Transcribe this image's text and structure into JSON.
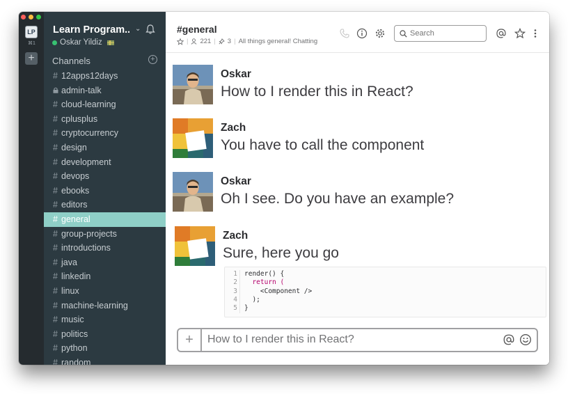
{
  "colors": {
    "sidebar_bg": "#2c3a41",
    "strip_bg": "#252b2f",
    "active_channel": "#8fcfc7",
    "presence": "#38c172",
    "traffic_red": "#fc605c",
    "traffic_yellow": "#fdbc40",
    "traffic_green": "#34c84a"
  },
  "strip": {
    "team_initials": "LP",
    "team_shortcut": "⌘1",
    "add_icon": "+"
  },
  "sidebar": {
    "team_name": "Learn Program...",
    "user_name": "Oskar Yildiz",
    "channels_header": "Channels",
    "channels": [
      {
        "prefix": "#",
        "name": "12apps12days"
      },
      {
        "prefix": "lock",
        "name": "admin-talk"
      },
      {
        "prefix": "#",
        "name": "cloud-learning"
      },
      {
        "prefix": "#",
        "name": "cplusplus"
      },
      {
        "prefix": "#",
        "name": "cryptocurrency"
      },
      {
        "prefix": "#",
        "name": "design"
      },
      {
        "prefix": "#",
        "name": "development"
      },
      {
        "prefix": "#",
        "name": "devops"
      },
      {
        "prefix": "#",
        "name": "ebooks"
      },
      {
        "prefix": "#",
        "name": "editors"
      },
      {
        "prefix": "#",
        "name": "general",
        "active": true
      },
      {
        "prefix": "#",
        "name": "group-projects"
      },
      {
        "prefix": "#",
        "name": "introductions"
      },
      {
        "prefix": "#",
        "name": "java"
      },
      {
        "prefix": "#",
        "name": "linkedin"
      },
      {
        "prefix": "#",
        "name": "linux"
      },
      {
        "prefix": "#",
        "name": "machine-learning"
      },
      {
        "prefix": "#",
        "name": "music"
      },
      {
        "prefix": "#",
        "name": "politics"
      },
      {
        "prefix": "#",
        "name": "python"
      },
      {
        "prefix": "#",
        "name": "random"
      }
    ]
  },
  "header": {
    "channel_name": "#general",
    "member_count": "221",
    "pinned_count": "3",
    "topic": "All things general! Chatting",
    "search_placeholder": "Search"
  },
  "messages": [
    {
      "sender": "Oskar",
      "text": "How to I render this in React?",
      "avatar": "oskar-avatar"
    },
    {
      "sender": "Zach",
      "text": "You have to call the component",
      "avatar": "zach-avatar"
    },
    {
      "sender": "Oskar",
      "text": "Oh I see. Do you have an example?",
      "avatar": "oskar-avatar"
    },
    {
      "sender": "Zach",
      "text": "Sure, here you go",
      "avatar": "zach-avatar"
    }
  ],
  "code_snippet": {
    "line_numbers": [
      "1",
      "2",
      "3",
      "4",
      "5"
    ],
    "lines": [
      "render() {",
      "  return (",
      "    <Component />",
      "  );",
      "}"
    ]
  },
  "composer": {
    "value": "How to I render this in React?",
    "add_icon": "+"
  }
}
